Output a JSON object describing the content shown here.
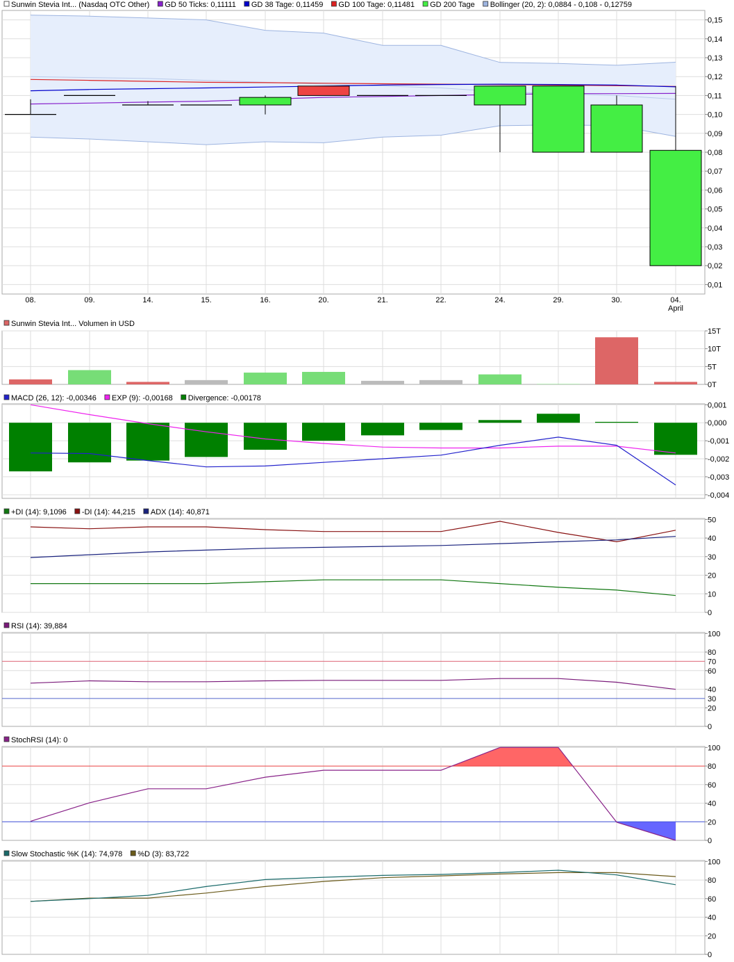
{
  "dates": [
    "08.",
    "09.",
    "14.",
    "15.",
    "16.",
    "20.",
    "21.",
    "22.",
    "24.",
    "29.",
    "30.",
    "04."
  ],
  "month_label": "April",
  "colors": {
    "up": "#44ee44",
    "down": "#ee4444",
    "volume_up": "#77dd77",
    "volume_down": "#dd6666",
    "volume_neutral": "#bbbbbb",
    "gd50": "#8822cc",
    "gd38": "#0000cc",
    "gd100": "#dd2222",
    "gd200": "#22cc22",
    "bollinger": "#9db4e0",
    "bollinger_fill": "#e6eefc",
    "macd": "#2222cc",
    "exp": "#ee22ee",
    "divergence": "#008000",
    "plus_di": "#117711",
    "minus_di": "#881111",
    "adx": "#1a237e",
    "rsi": "#7a1a7a",
    "stochrsi": "#882288",
    "stochrsi_up": "#ff6666",
    "stochrsi_down": "#6666ff",
    "slow_k": "#1a6a6a",
    "slow_d": "#6a5a1a",
    "ref70": "#dd6677",
    "ref30": "#5566cc",
    "ref80": "#ee4444",
    "ref20": "#4455dd"
  },
  "legend_price": [
    {
      "color": "#ffffff",
      "text": "Sunwin Stevia Int... (Nasdaq OTC Other)"
    },
    {
      "color": "#8822cc",
      "text": "GD 50 Ticks: 0,11111"
    },
    {
      "color": "#0000cc",
      "text": "GD 38 Tage: 0,11459"
    },
    {
      "color": "#dd2222",
      "text": "GD 100 Tage: 0,11481"
    },
    {
      "color": "#44ee44",
      "text": "GD 200 Tage"
    },
    {
      "color": "#9db4e0",
      "text": "Bollinger (20, 2): 0,0884 - 0,108 - 0,12759"
    }
  ],
  "legend_volume": [
    {
      "color": "#dd6666",
      "text": "Sunwin Stevia Int... Volumen in USD"
    }
  ],
  "legend_macd": [
    {
      "color": "#2222cc",
      "text": "MACD (26, 12): -0,00346"
    },
    {
      "color": "#ee22ee",
      "text": "EXP (9): -0,00168"
    },
    {
      "color": "#008000",
      "text": "Divergence: -0,00178"
    }
  ],
  "legend_dmi": [
    {
      "color": "#117711",
      "text": "+DI (14): 9,1096"
    },
    {
      "color": "#881111",
      "text": "-DI (14): 44,215"
    },
    {
      "color": "#1a237e",
      "text": "ADX (14): 40,871"
    }
  ],
  "legend_rsi": [
    {
      "color": "#7a1a7a",
      "text": "RSI (14): 39,884"
    }
  ],
  "legend_stochrsi": [
    {
      "color": "#882288",
      "text": "StochRSI (14): 0"
    }
  ],
  "legend_slow": [
    {
      "color": "#1a6a6a",
      "text": "Slow Stochastic %K (14): 74,978"
    },
    {
      "color": "#6a5a1a",
      "text": "%D (3): 83,722"
    }
  ],
  "ticks": {
    "price": [
      "0,15",
      "0,14",
      "0,13",
      "0,12",
      "0,11",
      "0,10",
      "0,09",
      "0,08",
      "0,07",
      "0,06",
      "0,05",
      "0,04",
      "0,03",
      "0,02",
      "0,01"
    ],
    "volume": [
      "15T",
      "10T",
      "5T",
      "0T"
    ],
    "macd": [
      "0,001",
      "0,000",
      "-0,001",
      "-0,002",
      "-0,003",
      "-0,004"
    ],
    "dmi": [
      "50",
      "40",
      "30",
      "20",
      "10",
      "0"
    ],
    "rsi": [
      "100",
      "80",
      "60",
      "40",
      "20",
      "0"
    ],
    "rsi_refs": [
      "70",
      "30"
    ],
    "stochrsi": [
      "100",
      "80",
      "60",
      "40",
      "20",
      "0"
    ],
    "stochrsi_refs": [
      "80",
      "20"
    ],
    "slow": [
      "100",
      "80",
      "60",
      "40",
      "20",
      "0"
    ]
  },
  "chart_data": [
    {
      "type": "candlestick",
      "title": "Sunwin Stevia Int... (Nasdaq OTC Other)",
      "x": [
        "08.",
        "09.",
        "14.",
        "15.",
        "16.",
        "20.",
        "21.",
        "22.",
        "24.",
        "29.",
        "30.",
        "04. April"
      ],
      "ylim": [
        0.005,
        0.155
      ],
      "ohlc": [
        {
          "o": 0.1,
          "h": 0.108,
          "l": 0.1,
          "c": 0.1
        },
        {
          "o": 0.11,
          "h": 0.11,
          "l": 0.11,
          "c": 0.11
        },
        {
          "o": 0.105,
          "h": 0.107,
          "l": 0.105,
          "c": 0.105
        },
        {
          "o": 0.105,
          "h": 0.105,
          "l": 0.105,
          "c": 0.105
        },
        {
          "o": 0.105,
          "h": 0.11,
          "l": 0.1,
          "c": 0.109
        },
        {
          "o": 0.115,
          "h": 0.115,
          "l": 0.11,
          "c": 0.11
        },
        {
          "o": 0.11,
          "h": 0.11,
          "l": 0.11,
          "c": 0.11
        },
        {
          "o": 0.11,
          "h": 0.11,
          "l": 0.11,
          "c": 0.11
        },
        {
          "o": 0.105,
          "h": 0.115,
          "l": 0.08,
          "c": 0.115
        },
        {
          "o": 0.08,
          "h": 0.115,
          "l": 0.08,
          "c": 0.115
        },
        {
          "o": 0.08,
          "h": 0.11,
          "l": 0.08,
          "c": 0.105
        },
        {
          "o": 0.02,
          "h": 0.115,
          "l": 0.02,
          "c": 0.081
        }
      ],
      "series": [
        {
          "name": "GD 50 Ticks: 0,11111",
          "values": [
            0.1055,
            0.106,
            0.1065,
            0.107,
            0.108,
            0.109,
            0.1095,
            0.11,
            0.1105,
            0.111,
            0.111,
            0.1111
          ]
        },
        {
          "name": "GD 38 Tage: 0,11459",
          "values": [
            0.1125,
            0.1132,
            0.1136,
            0.114,
            0.1145,
            0.115,
            0.1155,
            0.1158,
            0.116,
            0.1158,
            0.1155,
            0.1146
          ]
        },
        {
          "name": "GD 100 Tage: 0,11481",
          "values": [
            0.1185,
            0.118,
            0.1175,
            0.117,
            0.1168,
            0.1165,
            0.1162,
            0.116,
            0.1158,
            0.1155,
            0.1152,
            0.1148
          ]
        },
        {
          "name": "Bollinger upper",
          "values": [
            0.1525,
            0.152,
            0.151,
            0.15,
            0.1445,
            0.143,
            0.1365,
            0.1365,
            0.1275,
            0.127,
            0.126,
            0.1276
          ]
        },
        {
          "name": "Bollinger middle",
          "values": [
            0.12,
            0.1195,
            0.119,
            0.118,
            0.117,
            0.116,
            0.115,
            0.114,
            0.112,
            0.111,
            0.11,
            0.108
          ]
        },
        {
          "name": "Bollinger lower",
          "values": [
            0.088,
            0.087,
            0.0855,
            0.084,
            0.0855,
            0.085,
            0.088,
            0.089,
            0.094,
            0.0945,
            0.094,
            0.0884
          ]
        }
      ]
    },
    {
      "type": "bar",
      "title": "Sunwin Stevia Int... Volumen in USD",
      "categories": [
        "08.",
        "09.",
        "14.",
        "15.",
        "16.",
        "20.",
        "21.",
        "22.",
        "24.",
        "29.",
        "30.",
        "04."
      ],
      "values": [
        1.4,
        4.0,
        0.7,
        1.2,
        3.3,
        3.5,
        1.0,
        1.2,
        2.8,
        0.1,
        13.2,
        0.7
      ],
      "direction": [
        "down",
        "up",
        "down",
        "neutral",
        "up",
        "up",
        "neutral",
        "neutral",
        "up",
        "up",
        "down",
        "down"
      ],
      "unit": "T",
      "ylim": [
        0,
        15
      ]
    },
    {
      "type": "bar+line",
      "categories": [
        "08.",
        "09.",
        "14.",
        "15.",
        "16.",
        "20.",
        "21.",
        "22.",
        "24.",
        "29.",
        "30.",
        "04."
      ],
      "ylim": [
        -0.004,
        0.001
      ],
      "series": [
        {
          "name": "Divergence: -0,00178",
          "type": "bar",
          "values": [
            -0.0027,
            -0.0022,
            -0.0021,
            -0.0019,
            -0.0015,
            -0.001,
            -0.0007,
            -0.0004,
            0.00015,
            0.0005,
            5e-05,
            -0.00178
          ]
        },
        {
          "name": "MACD (26, 12): -0,00346",
          "values": [
            -0.00168,
            -0.00171,
            -0.0021,
            -0.00245,
            -0.0024,
            -0.0022,
            -0.002,
            -0.0018,
            -0.00125,
            -0.0008,
            -0.00125,
            -0.00346
          ]
        },
        {
          "name": "EXP (9): -0,00168",
          "values": [
            0.001,
            0.00045,
            -5e-05,
            -0.0005,
            -0.0009,
            -0.00115,
            -0.00135,
            -0.0014,
            -0.0014,
            -0.0013,
            -0.0013,
            -0.00168
          ]
        }
      ]
    },
    {
      "type": "line",
      "categories": [
        "08.",
        "09.",
        "14.",
        "15.",
        "16.",
        "20.",
        "21.",
        "22.",
        "24.",
        "29.",
        "30.",
        "04."
      ],
      "ylim": [
        0,
        50
      ],
      "series": [
        {
          "name": "+DI (14): 9,1096",
          "values": [
            15.5,
            15.5,
            15.5,
            15.5,
            16.5,
            17.5,
            17.5,
            17.5,
            15.5,
            13.5,
            12.0,
            9.1
          ]
        },
        {
          "name": "-DI (14): 44,215",
          "values": [
            46.0,
            45.0,
            46.0,
            46.0,
            44.5,
            43.5,
            43.5,
            43.5,
            49.0,
            43.0,
            38.0,
            44.2
          ]
        },
        {
          "name": "ADX (14): 40,871",
          "values": [
            29.5,
            31.0,
            32.5,
            33.5,
            34.5,
            35.0,
            35.5,
            36.0,
            37.0,
            38.0,
            39.0,
            40.9
          ]
        }
      ]
    },
    {
      "type": "line",
      "categories": [
        "08.",
        "09.",
        "14.",
        "15.",
        "16.",
        "20.",
        "21.",
        "22.",
        "24.",
        "29.",
        "30.",
        "04."
      ],
      "ylim": [
        0,
        100
      ],
      "reference_lines": [
        70,
        30
      ],
      "series": [
        {
          "name": "RSI (14): 39,884",
          "values": [
            46.5,
            49.0,
            48.0,
            48.0,
            49.0,
            49.5,
            49.5,
            49.5,
            51.5,
            51.5,
            47.5,
            39.9
          ]
        }
      ]
    },
    {
      "type": "line",
      "categories": [
        "08.",
        "09.",
        "14.",
        "15.",
        "16.",
        "20.",
        "21.",
        "22.",
        "24.",
        "29.",
        "30.",
        "04."
      ],
      "ylim": [
        0,
        100
      ],
      "reference_lines": [
        80,
        20
      ],
      "series": [
        {
          "name": "StochRSI (14): 0",
          "values": [
            20.5,
            40.5,
            55.5,
            55.5,
            68.0,
            75.5,
            75.5,
            75.5,
            100.0,
            100.0,
            19.5,
            0.0
          ]
        }
      ]
    },
    {
      "type": "line",
      "categories": [
        "08.",
        "09.",
        "14.",
        "15.",
        "16.",
        "20.",
        "21.",
        "22.",
        "24.",
        "29.",
        "30.",
        "04."
      ],
      "ylim": [
        0,
        100
      ],
      "series": [
        {
          "name": "Slow Stochastic %K (14): 74,978",
          "values": [
            57.0,
            60.0,
            63.5,
            73.0,
            80.5,
            83.0,
            85.0,
            86.0,
            88.0,
            90.5,
            85.5,
            75.0
          ]
        },
        {
          "name": "%D (3): 83,722",
          "values": [
            57.0,
            60.5,
            60.5,
            66.0,
            73.0,
            78.5,
            82.5,
            84.5,
            86.5,
            88.0,
            88.0,
            83.7
          ]
        }
      ]
    }
  ]
}
